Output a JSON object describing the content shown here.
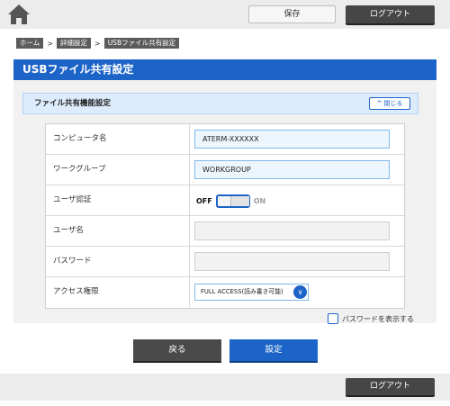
{
  "header": {
    "home_icon": "home-icon",
    "save_label": "保存",
    "logout_label": "ログアウト"
  },
  "breadcrumb": {
    "items": [
      "ホーム",
      "詳細設定",
      "USBファイル共有設定"
    ],
    "separator": ">"
  },
  "page": {
    "title": "USBファイル共有設定"
  },
  "section": {
    "title": "ファイル共有機能設定",
    "close_label": "閉じる"
  },
  "form": {
    "computer_name": {
      "label": "コンピュータ名",
      "value": "ATERM-XXXXXX"
    },
    "workgroup": {
      "label": "ワークグループ",
      "value": "WORKGROUP"
    },
    "user_auth": {
      "label": "ユーザ認証",
      "off_label": "OFF",
      "on_label": "ON",
      "state": "OFF"
    },
    "username": {
      "label": "ユーザ名",
      "value": ""
    },
    "password": {
      "label": "パスワード",
      "value": ""
    },
    "access": {
      "label": "アクセス権限",
      "selected": "FULL ACCESS(読み書き可能)"
    }
  },
  "show_password": {
    "label": "パスワードを表示する",
    "checked": false
  },
  "actions": {
    "back_label": "戻る",
    "set_label": "設定"
  },
  "footer": {
    "logout_label": "ログアウト"
  },
  "colors": {
    "accent": "#1c64c7",
    "dark_button": "#464646",
    "section_bg": "#ddecfc"
  }
}
